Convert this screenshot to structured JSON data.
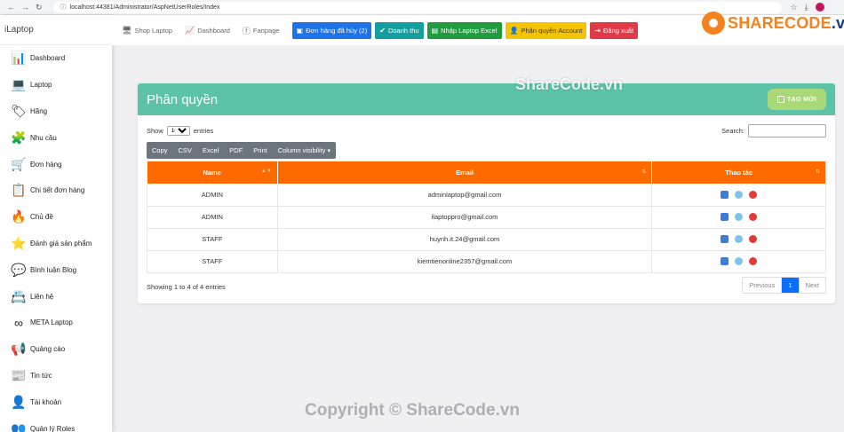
{
  "browser": {
    "url": "localhost:44381/Administrator/AspNetUserRoles/Index"
  },
  "sidebar": {
    "brand": "iLaptop",
    "items": [
      {
        "label": "Dashboard",
        "icon": "dashboard-icon",
        "glyph": "📊"
      },
      {
        "label": "Laptop",
        "icon": "laptop-icon",
        "glyph": "💻"
      },
      {
        "label": "Hãng",
        "icon": "brand-icon",
        "glyph": "🏷"
      },
      {
        "label": "Nhu cầu",
        "icon": "needs-icon",
        "glyph": "🧩"
      },
      {
        "label": "Đơn hàng",
        "icon": "cart-icon",
        "glyph": "🛒"
      },
      {
        "label": "Chi tiết đơn hàng",
        "icon": "clipboard-icon",
        "glyph": "📋"
      },
      {
        "label": "Chủ đề",
        "icon": "topic-icon",
        "glyph": "🔥"
      },
      {
        "label": "Đánh giá sản phẩm",
        "icon": "rating-icon",
        "glyph": "⭐"
      },
      {
        "label": "Bình luận Blog",
        "icon": "comment-icon",
        "glyph": "💬"
      },
      {
        "label": "Liên hệ",
        "icon": "contact-icon",
        "glyph": "📇"
      },
      {
        "label": "META Laptop",
        "icon": "meta-icon",
        "glyph": "∞"
      },
      {
        "label": "Quảng cáo",
        "icon": "ads-icon",
        "glyph": "📢"
      },
      {
        "label": "Tin tức",
        "icon": "news-icon",
        "glyph": "📰"
      },
      {
        "label": "Tài khoản",
        "icon": "user-icon",
        "glyph": "👤"
      },
      {
        "label": "Quản lý Roles",
        "icon": "roles-icon",
        "glyph": "👥"
      }
    ]
  },
  "topnav": {
    "links": [
      {
        "label": "Shop Laptop",
        "icon": "shop-icon",
        "glyph": "🖥"
      },
      {
        "label": "Dashboard",
        "icon": "dashboard-icon",
        "glyph": "📈"
      },
      {
        "label": "Fanpage",
        "icon": "facebook-icon",
        "glyph": "ⓕ"
      }
    ],
    "buttons": [
      {
        "label": "Đơn hàng đã hủy (2)",
        "icon": "cancel-order-icon",
        "glyph": "▣",
        "color": "#1e73e8"
      },
      {
        "label": "Doanh thu",
        "icon": "revenue-icon",
        "glyph": "✔",
        "color": "#139ea0"
      },
      {
        "label": "Nhập Laptop Excel",
        "icon": "excel-icon",
        "glyph": "▤",
        "color": "#1f9d3e"
      },
      {
        "label": "Phân quyền Account",
        "icon": "permission-icon",
        "glyph": "👤",
        "color": "#f5c400"
      },
      {
        "label": "Đăng xuất",
        "icon": "logout-icon",
        "glyph": "⇥",
        "color": "#e03a48"
      }
    ]
  },
  "logo": {
    "text": "SHARECODE",
    "domain": ".vn"
  },
  "card": {
    "title": "Phân quyền",
    "new_button": "TẠO MỚI",
    "show_label": "Show",
    "entries_value": "10",
    "entries_label": "entries",
    "search_label": "Search:",
    "export_buttons": [
      "Copy",
      "CSV",
      "Excel",
      "PDF",
      "Print",
      "Column visibility"
    ],
    "columns": [
      "Name",
      "Email",
      "Thao tác"
    ],
    "rows": [
      {
        "name": "ADMIN",
        "email": "adminlaptop@gmail.com"
      },
      {
        "name": "ADMIN",
        "email": "ilaptoppro@gmail.com"
      },
      {
        "name": "STAFF",
        "email": "huynh.it.24@gmail.com"
      },
      {
        "name": "STAFF",
        "email": "kiemtienonline2357@gmail.com"
      }
    ],
    "info": "Showing 1 to 4 of 4 entries",
    "pager": {
      "previous": "Previous",
      "current": "1",
      "next": "Next"
    }
  },
  "watermarks": {
    "center": "ShareCode.vn",
    "bottom": "Copyright © ShareCode.vn"
  }
}
